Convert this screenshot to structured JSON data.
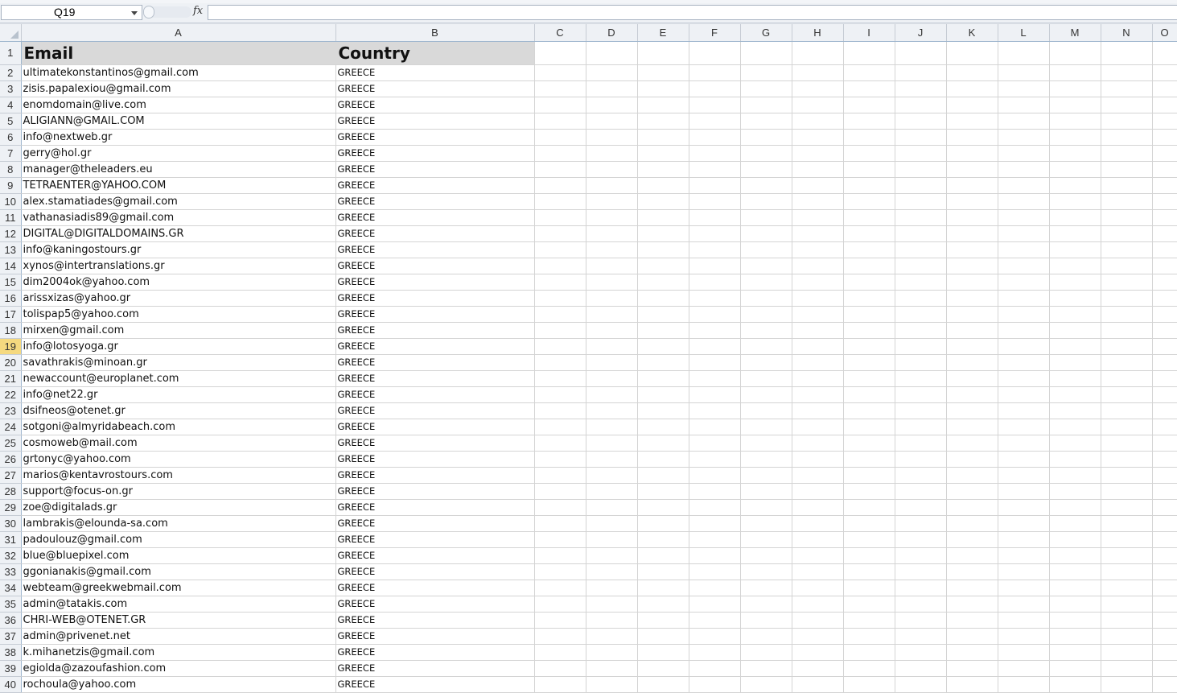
{
  "namebox": {
    "value": "Q19"
  },
  "formula_bar": {
    "fx_label": "fx",
    "value": ""
  },
  "columns": [
    "A",
    "B",
    "C",
    "D",
    "E",
    "F",
    "G",
    "H",
    "I",
    "J",
    "K",
    "L",
    "M",
    "N",
    "O"
  ],
  "active_cell": "Q19",
  "header_row": {
    "row": "1",
    "email": "Email",
    "country": "Country"
  },
  "rows": [
    {
      "row": "2",
      "email": "ultimatekonstantinos@gmail.com",
      "country": "GREECE"
    },
    {
      "row": "3",
      "email": "zisis.papalexiou@gmail.com",
      "country": "GREECE"
    },
    {
      "row": "4",
      "email": "enomdomain@live.com",
      "country": "GREECE"
    },
    {
      "row": "5",
      "email": "ALIGIANN@GMAIL.COM",
      "country": "GREECE"
    },
    {
      "row": "6",
      "email": "info@nextweb.gr",
      "country": "GREECE"
    },
    {
      "row": "7",
      "email": "gerry@hol.gr",
      "country": "GREECE"
    },
    {
      "row": "8",
      "email": "manager@theleaders.eu",
      "country": "GREECE"
    },
    {
      "row": "9",
      "email": "TETRAENTER@YAHOO.COM",
      "country": "GREECE"
    },
    {
      "row": "10",
      "email": "alex.stamatiades@gmail.com",
      "country": "GREECE"
    },
    {
      "row": "11",
      "email": "vathanasiadis89@gmail.com",
      "country": "GREECE"
    },
    {
      "row": "12",
      "email": "DIGITAL@DIGITALDOMAINS.GR",
      "country": "GREECE"
    },
    {
      "row": "13",
      "email": "info@kaningostours.gr",
      "country": "GREECE"
    },
    {
      "row": "14",
      "email": "xynos@intertranslations.gr",
      "country": "GREECE"
    },
    {
      "row": "15",
      "email": "dim2004ok@yahoo.com",
      "country": "GREECE"
    },
    {
      "row": "16",
      "email": "arissxizas@yahoo.gr",
      "country": "GREECE"
    },
    {
      "row": "17",
      "email": "tolispap5@yahoo.com",
      "country": "GREECE"
    },
    {
      "row": "18",
      "email": "mirxen@gmail.com",
      "country": "GREECE"
    },
    {
      "row": "19",
      "email": "info@lotosyoga.gr",
      "country": "GREECE"
    },
    {
      "row": "20",
      "email": "savathrakis@minoan.gr",
      "country": "GREECE"
    },
    {
      "row": "21",
      "email": "newaccount@europlanet.com",
      "country": "GREECE"
    },
    {
      "row": "22",
      "email": "info@net22.gr",
      "country": "GREECE"
    },
    {
      "row": "23",
      "email": "dsifneos@otenet.gr",
      "country": "GREECE"
    },
    {
      "row": "24",
      "email": "sotgoni@almyridabeach.com",
      "country": "GREECE"
    },
    {
      "row": "25",
      "email": "cosmoweb@mail.com",
      "country": "GREECE"
    },
    {
      "row": "26",
      "email": "grtonyc@yahoo.com",
      "country": "GREECE"
    },
    {
      "row": "27",
      "email": "marios@kentavrostours.com",
      "country": "GREECE"
    },
    {
      "row": "28",
      "email": "support@focus-on.gr",
      "country": "GREECE"
    },
    {
      "row": "29",
      "email": "zoe@digitalads.gr",
      "country": "GREECE"
    },
    {
      "row": "30",
      "email": "lambrakis@elounda-sa.com",
      "country": "GREECE"
    },
    {
      "row": "31",
      "email": "padoulouz@gmail.com",
      "country": "GREECE"
    },
    {
      "row": "32",
      "email": "blue@bluepixel.com",
      "country": "GREECE"
    },
    {
      "row": "33",
      "email": "ggonianakis@gmail.com",
      "country": "GREECE"
    },
    {
      "row": "34",
      "email": "webteam@greekwebmail.com",
      "country": "GREECE"
    },
    {
      "row": "35",
      "email": "admin@tatakis.com",
      "country": "GREECE"
    },
    {
      "row": "36",
      "email": "CHRI-WEB@OTENET.GR",
      "country": "GREECE"
    },
    {
      "row": "37",
      "email": "admin@privenet.net",
      "country": "GREECE"
    },
    {
      "row": "38",
      "email": "k.mihanetzis@gmail.com",
      "country": "GREECE"
    },
    {
      "row": "39",
      "email": "egiolda@zazoufashion.com",
      "country": "GREECE"
    },
    {
      "row": "40",
      "email": "rochoula@yahoo.com",
      "country": "GREECE"
    }
  ],
  "colors": {
    "header_fill": "#d9d9d9",
    "active_row_header": "#f5d97f",
    "gridline": "#d4d4d4"
  }
}
